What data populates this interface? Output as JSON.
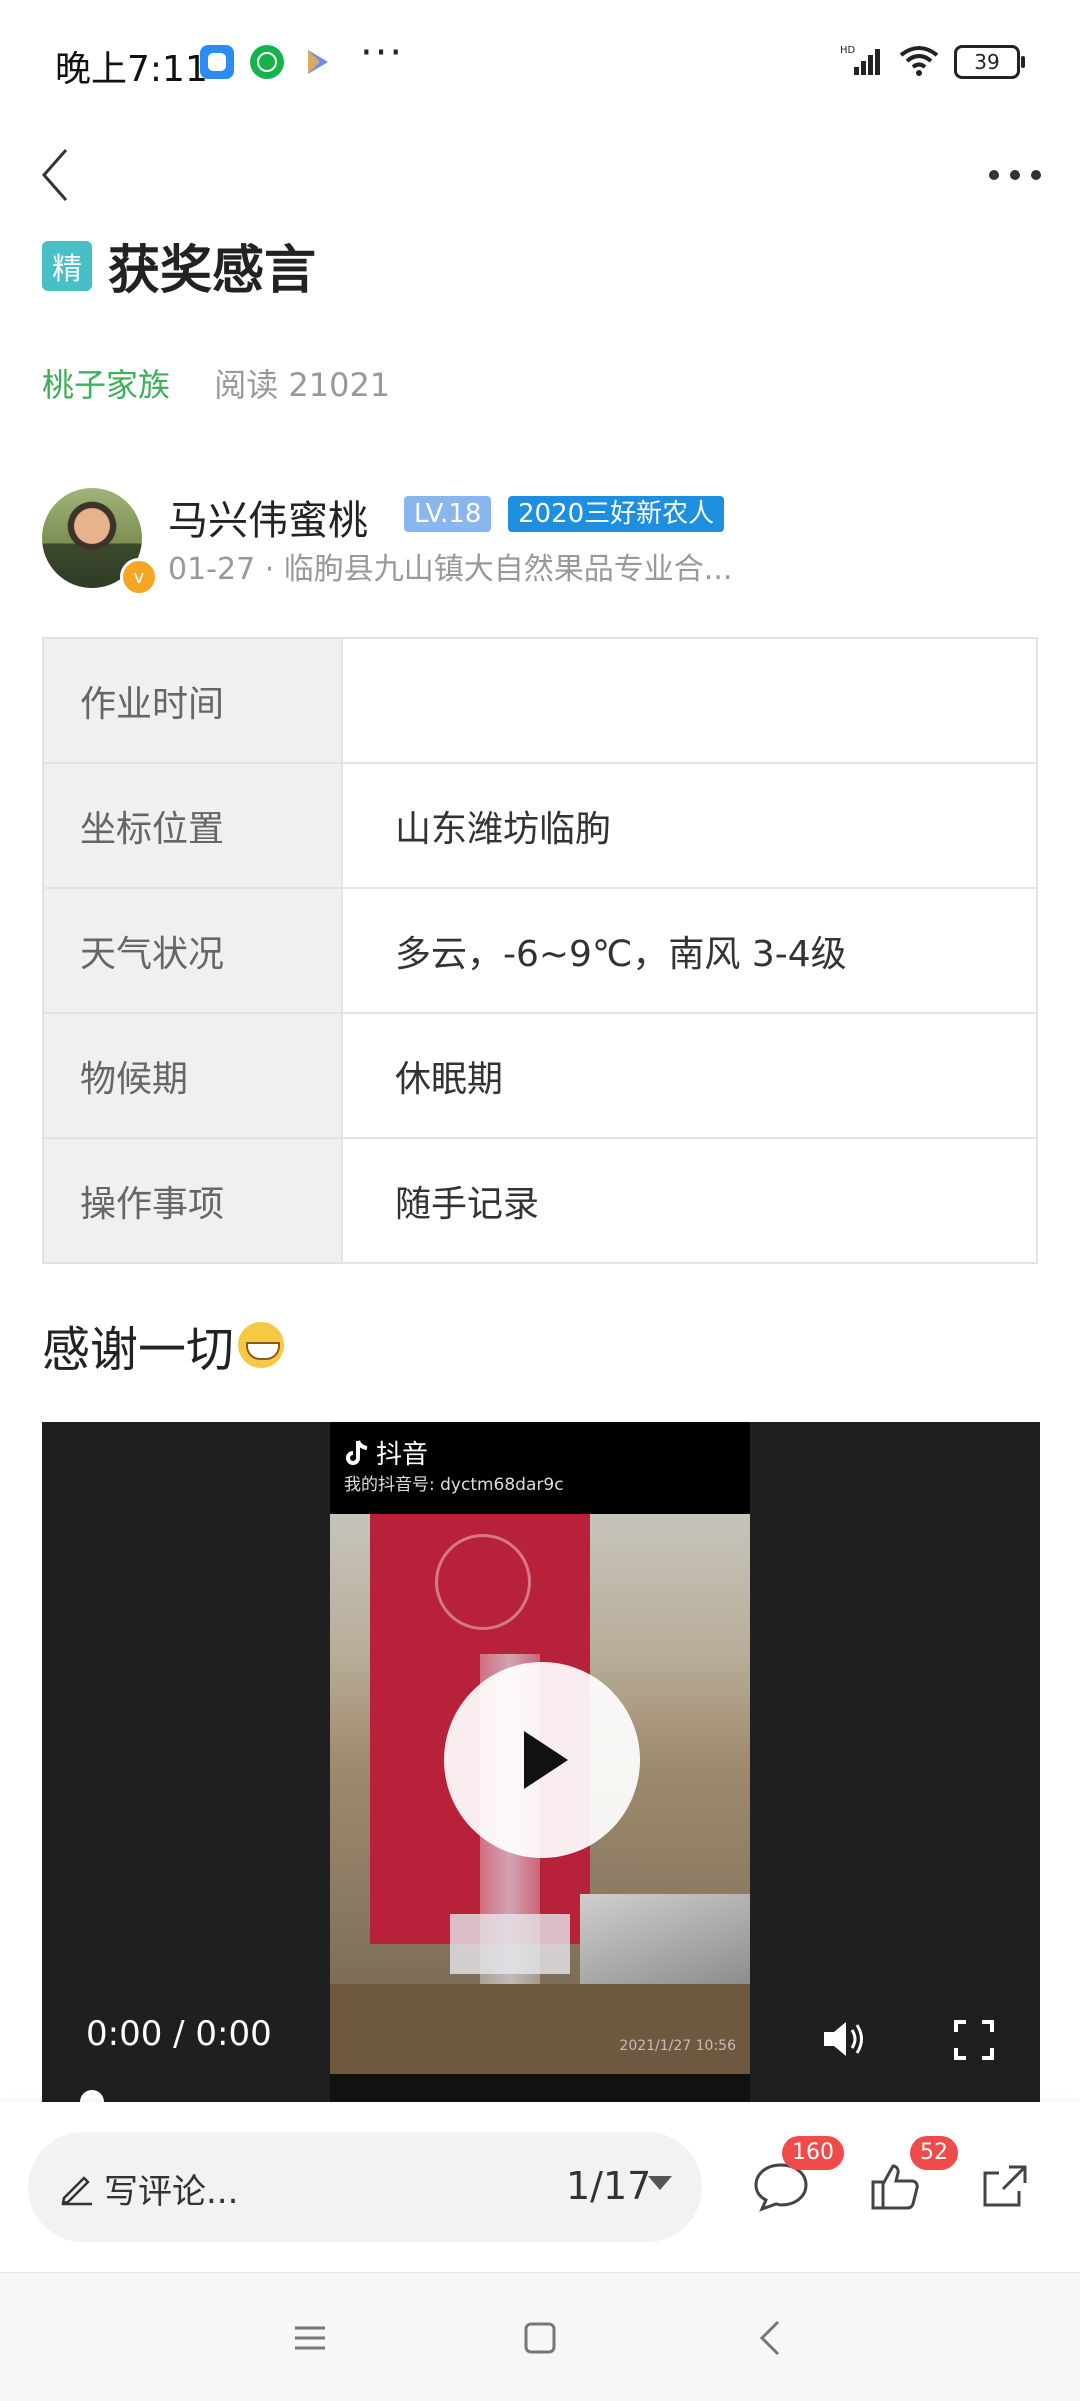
{
  "status_bar": {
    "time": "晚上7:11",
    "network_label": "HD",
    "battery": "39",
    "more": "···"
  },
  "post": {
    "badge": "精",
    "title": "获奖感言",
    "family": "桃子家族",
    "reads": "阅读 21021"
  },
  "author": {
    "name": "马兴伟蜜桃",
    "level": "LV.18",
    "award": "2020三好新农人",
    "verified_mark": "v",
    "sub": "01-27 · 临朐县九山镇大自然果品专业合..."
  },
  "info_table": [
    {
      "key": "作业时间",
      "value": ""
    },
    {
      "key": "坐标位置",
      "value": "山东潍坊临朐"
    },
    {
      "key": "天气状况",
      "value": "多云，-6~9℃，南风 3-4级"
    },
    {
      "key": "物候期",
      "value": "休眠期"
    },
    {
      "key": "操作事项",
      "value": "随手记录"
    }
  ],
  "body": {
    "text": "感谢一切"
  },
  "video": {
    "watermark_app": "抖音",
    "watermark_id": "我的抖音号: dyctm68dar9c",
    "timestamp_stamp": "2021/1/27 10:56",
    "time_display": "0:00 / 0:00"
  },
  "action_bar": {
    "comment_placeholder": "写评论...",
    "page_indicator": "1/17",
    "comment_count": "160",
    "like_count": "52"
  },
  "icons": {
    "back": "back-arrow-icon",
    "more": "more-dots-icon",
    "play": "play-icon",
    "volume": "volume-icon",
    "fullscreen": "fullscreen-icon",
    "comment": "comment-icon",
    "like": "thumbs-up-icon",
    "share": "share-icon"
  },
  "colors": {
    "accent_green": "#3dae5a",
    "badge_teal": "#48bfc6",
    "badge_red": "#f04b4b",
    "award_blue": "#1d8fe0"
  }
}
